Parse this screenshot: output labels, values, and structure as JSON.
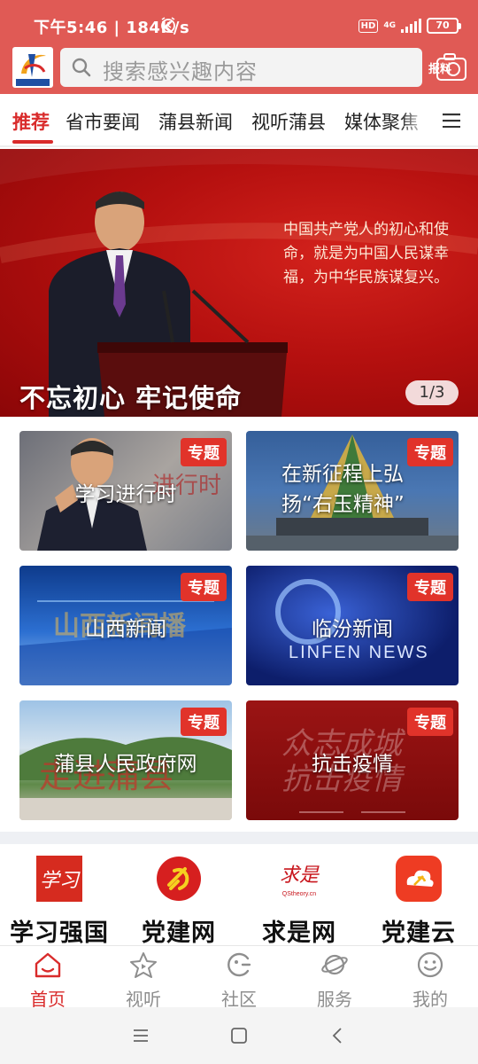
{
  "status_bar": {
    "time": "下午5:46 | 184K/s",
    "hd": "HD",
    "network": "4G",
    "battery": "70"
  },
  "header": {
    "logo_text": "蒲县融媒",
    "search_placeholder": "搜索感兴趣内容",
    "report_label": "报料"
  },
  "tabs": [
    {
      "label": "推荐",
      "active": true
    },
    {
      "label": "省市要闻"
    },
    {
      "label": "蒲县新闻"
    },
    {
      "label": "视听蒲县"
    },
    {
      "label": "媒体聚焦"
    }
  ],
  "banner": {
    "quote": "中国共产党人的初心和使命，就是为中国人民谋幸福，为中华民族谋复兴。",
    "title": "不忘初心 牢记使命",
    "counter": "1/3"
  },
  "topics": [
    {
      "title": "学习进行时",
      "badge": "专题"
    },
    {
      "title": "在新征程上弘扬“右玉精神”",
      "badge": "专题"
    },
    {
      "title": "山西新闻",
      "badge": "专题"
    },
    {
      "title": "临汾新闻",
      "badge": "专题"
    },
    {
      "title": "蒲县人民政府网",
      "badge": "专题"
    },
    {
      "title": "抗击疫情",
      "badge": "专题"
    }
  ],
  "quick_links": [
    {
      "name": "学习强国",
      "icon": "xuexi-icon"
    },
    {
      "name": "党建网",
      "icon": "party-emblem-icon"
    },
    {
      "name": "求是网",
      "icon": "qiushi-icon"
    },
    {
      "name": "党建云",
      "icon": "party-cloud-icon"
    }
  ],
  "bottom_nav": [
    {
      "label": "首页",
      "icon": "home-icon",
      "active": true
    },
    {
      "label": "视听",
      "icon": "star-icon"
    },
    {
      "label": "社区",
      "icon": "community-icon"
    },
    {
      "label": "服务",
      "icon": "planet-icon"
    },
    {
      "label": "我的",
      "icon": "smile-icon"
    }
  ],
  "colors": {
    "brand_red": "#e05a55",
    "accent": "#d92b2b",
    "badge": "#e1332a"
  }
}
